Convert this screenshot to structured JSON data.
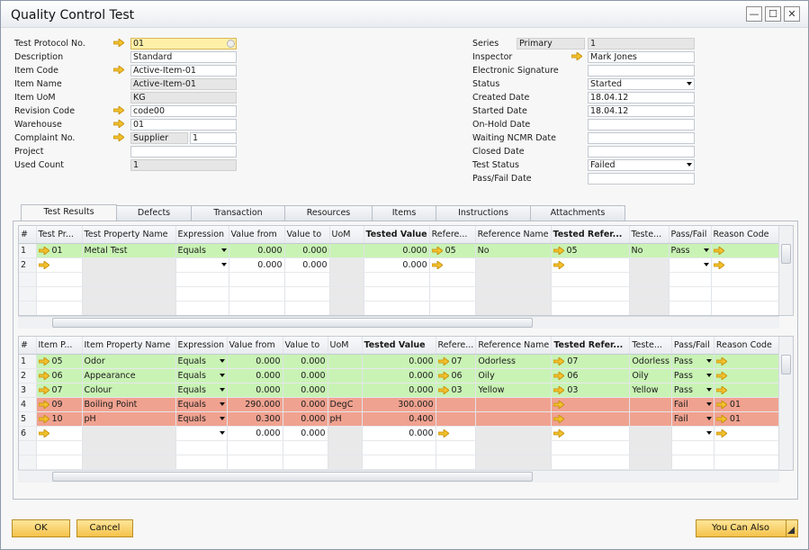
{
  "window": {
    "title": "Quality Control Test",
    "minimize": "—",
    "maximize": "☐",
    "close": "✕"
  },
  "left_fields": [
    {
      "label": "Test Protocol No.",
      "value": "01",
      "arrow": true,
      "style": "hl",
      "spin": true
    },
    {
      "label": "Description",
      "value": "Standard",
      "arrow": false,
      "style": ""
    },
    {
      "label": "Item Code",
      "value": "Active-Item-01",
      "arrow": true,
      "style": ""
    },
    {
      "label": "Item Name",
      "value": "Active-Item-01",
      "arrow": false,
      "style": "ro"
    },
    {
      "label": "Item UoM",
      "value": "KG",
      "arrow": false,
      "style": "ro"
    },
    {
      "label": "Revision Code",
      "value": "code00",
      "arrow": true,
      "style": ""
    },
    {
      "label": "Warehouse",
      "value": "01",
      "arrow": true,
      "style": ""
    },
    {
      "label": "Complaint No.",
      "value": "Supplier",
      "value2": "1",
      "arrow": true,
      "style": "ro"
    },
    {
      "label": "Project",
      "value": "",
      "arrow": false,
      "style": ""
    },
    {
      "label": "Used Count",
      "value": "1",
      "arrow": false,
      "style": "ro"
    }
  ],
  "right_fields": [
    {
      "label": "Series",
      "value": "Primary",
      "value2": "1",
      "style": "ro"
    },
    {
      "label": "Inspector",
      "value": "Mark Jones",
      "arrow": true,
      "style": ""
    },
    {
      "label": "Electronic Signature",
      "value": "",
      "style": ""
    },
    {
      "label": "Status",
      "value": "Started",
      "dropdown": true,
      "style": ""
    },
    {
      "label": "Created Date",
      "value": "18.04.12",
      "style": ""
    },
    {
      "label": "Started Date",
      "value": "18.04.12",
      "style": ""
    },
    {
      "label": "On-Hold Date",
      "value": "",
      "style": ""
    },
    {
      "label": "Waiting NCMR Date",
      "value": "",
      "style": ""
    },
    {
      "label": "Closed Date",
      "value": "",
      "style": ""
    },
    {
      "label": "Test Status",
      "value": "Failed",
      "dropdown": true,
      "style": ""
    },
    {
      "label": "Pass/Fail Date",
      "value": "",
      "style": ""
    }
  ],
  "tabs": [
    "Test Results",
    "Defects",
    "Transaction",
    "Resources",
    "Items",
    "Instructions",
    "Attachments"
  ],
  "active_tab": 0,
  "grid1": {
    "headers": [
      "#",
      "Test Pr...",
      "Test Property Name",
      "Expression",
      "Value from",
      "Value to",
      "UoM",
      "Tested Value",
      "Refere...",
      "Reference Name",
      "Tested Refer...",
      "Teste...",
      "Pass/Fail",
      "Reason Code"
    ],
    "rows": [
      {
        "status": "green",
        "cells": [
          "1",
          "01",
          "Metal Test",
          "Equals",
          "0.000",
          "0.000",
          "",
          "0.000",
          "05",
          "No",
          "05",
          "No",
          "Pass",
          ""
        ]
      },
      {
        "status": "",
        "cells": [
          "2",
          "",
          "",
          "",
          "0.000",
          "0.000",
          "",
          "0.000",
          "",
          "",
          "",
          "",
          "",
          ""
        ]
      }
    ]
  },
  "grid2": {
    "headers": [
      "#",
      "Item P...",
      "Item Property Name",
      "Expression",
      "Value from",
      "Value to",
      "UoM",
      "Tested Value",
      "Refere...",
      "Reference Name",
      "Tested Refer...",
      "Teste...",
      "Pass/Fail",
      "Reason Code"
    ],
    "rows": [
      {
        "status": "green",
        "cells": [
          "1",
          "05",
          "Odor",
          "Equals",
          "0.000",
          "0.000",
          "",
          "0.000",
          "07",
          "Odorless",
          "07",
          "Odorless",
          "Pass",
          ""
        ]
      },
      {
        "status": "green",
        "cells": [
          "2",
          "06",
          "Appearance",
          "Equals",
          "0.000",
          "0.000",
          "",
          "0.000",
          "06",
          "Oily",
          "06",
          "Oily",
          "Pass",
          ""
        ]
      },
      {
        "status": "green",
        "cells": [
          "3",
          "07",
          "Colour",
          "Equals",
          "0.000",
          "0.000",
          "",
          "0.000",
          "03",
          "Yellow",
          "03",
          "Yellow",
          "Pass",
          ""
        ]
      },
      {
        "status": "red",
        "cells": [
          "4",
          "09",
          "Boiling Point",
          "Equals",
          "290.000",
          "0.000",
          "DegC",
          "300.000",
          "",
          "",
          "",
          "",
          "Fail",
          "01"
        ]
      },
      {
        "status": "red",
        "cells": [
          "5",
          "10",
          "pH",
          "Equals",
          "0.300",
          "0.000",
          "pH",
          "0.400",
          "",
          "",
          "",
          "",
          "Fail",
          "01"
        ]
      },
      {
        "status": "",
        "cells": [
          "6",
          "",
          "",
          "",
          "0.000",
          "0.000",
          "",
          "0.000",
          "",
          "",
          "",
          "",
          "",
          ""
        ]
      }
    ]
  },
  "buttons": {
    "ok": "OK",
    "cancel": "Cancel",
    "you_can_also": "You Can Also"
  },
  "colors": {
    "pass_row": "#c9f3b5",
    "fail_row": "#f0a290",
    "link_arrow": "#f2c12e"
  }
}
